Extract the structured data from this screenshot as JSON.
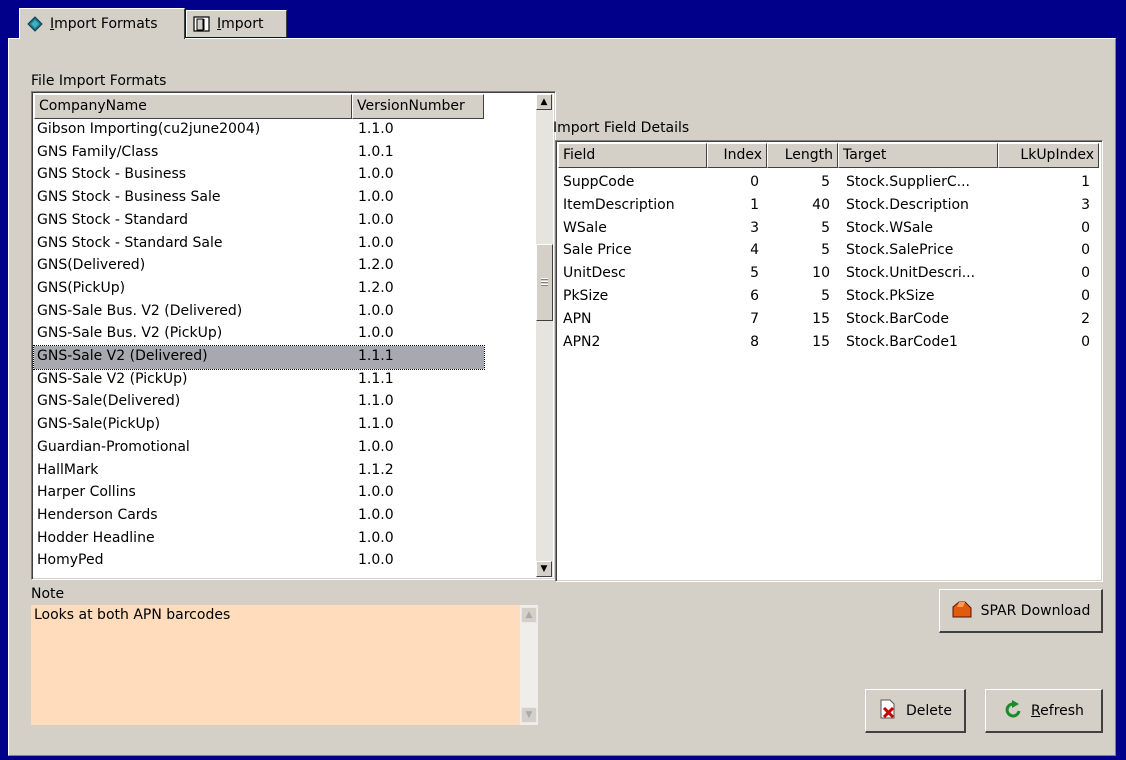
{
  "tabs": [
    {
      "label_prefix": "",
      "label_u": "I",
      "label_rest": "mport Formats",
      "icon": "book-icon"
    },
    {
      "label_prefix": "",
      "label_u": "I",
      "label_rest": "mport",
      "icon": "door-icon"
    }
  ],
  "formats": {
    "group_label": "File Import Formats",
    "columns": [
      "CompanyName",
      "VersionNumber"
    ],
    "rows": [
      [
        "Gibson Importing(cu2june2004)",
        "1.1.0"
      ],
      [
        "GNS Family/Class",
        "1.0.1"
      ],
      [
        "GNS Stock - Business",
        "1.0.0"
      ],
      [
        "GNS Stock - Business Sale",
        "1.0.0"
      ],
      [
        "GNS Stock - Standard",
        "1.0.0"
      ],
      [
        "GNS Stock - Standard Sale",
        "1.0.0"
      ],
      [
        "GNS(Delivered)",
        "1.2.0"
      ],
      [
        "GNS(PickUp)",
        "1.2.0"
      ],
      [
        "GNS-Sale Bus. V2 (Delivered)",
        "1.0.0"
      ],
      [
        "GNS-Sale Bus. V2 (PickUp)",
        "1.0.0"
      ],
      [
        "GNS-Sale V2 (Delivered)",
        "1.1.1"
      ],
      [
        "GNS-Sale V2 (PickUp)",
        "1.1.1"
      ],
      [
        "GNS-Sale(Delivered)",
        "1.1.0"
      ],
      [
        "GNS-Sale(PickUp)",
        "1.1.0"
      ],
      [
        "Guardian-Promotional",
        "1.0.0"
      ],
      [
        "HallMark",
        "1.1.2"
      ],
      [
        "Harper Collins",
        "1.0.0"
      ],
      [
        "Henderson Cards",
        "1.0.0"
      ],
      [
        "Hodder Headline",
        "1.0.0"
      ],
      [
        "HomyPed",
        "1.0.0"
      ]
    ],
    "selected_index": 10
  },
  "fields": {
    "group_label": "Import Field Details",
    "columns": [
      "Field",
      "Index",
      "Length",
      "Target",
      "LkUpIndex"
    ],
    "rows": [
      [
        "SuppCode",
        "0",
        "5",
        "Stock.SupplierC...",
        "1"
      ],
      [
        "ItemDescription",
        "1",
        "40",
        "Stock.Description",
        "3"
      ],
      [
        "WSale",
        "3",
        "5",
        "Stock.WSale",
        "0"
      ],
      [
        "Sale Price",
        "4",
        "5",
        "Stock.SalePrice",
        "0"
      ],
      [
        "UnitDesc",
        "5",
        "10",
        "Stock.UnitDescri...",
        "0"
      ],
      [
        "PkSize",
        "6",
        "5",
        "Stock.PkSize",
        "0"
      ],
      [
        "APN",
        "7",
        "15",
        "Stock.BarCode",
        "2"
      ],
      [
        "APN2",
        "8",
        "15",
        "Stock.BarCode1",
        "0"
      ]
    ]
  },
  "note": {
    "label": "Note",
    "text": "Looks at both APN barcodes",
    "bg_color": "#ffdcbc"
  },
  "buttons": {
    "spar_label": "SPAR Download",
    "delete_label": "Delete",
    "refresh_u": "R",
    "refresh_rest": "efresh"
  }
}
